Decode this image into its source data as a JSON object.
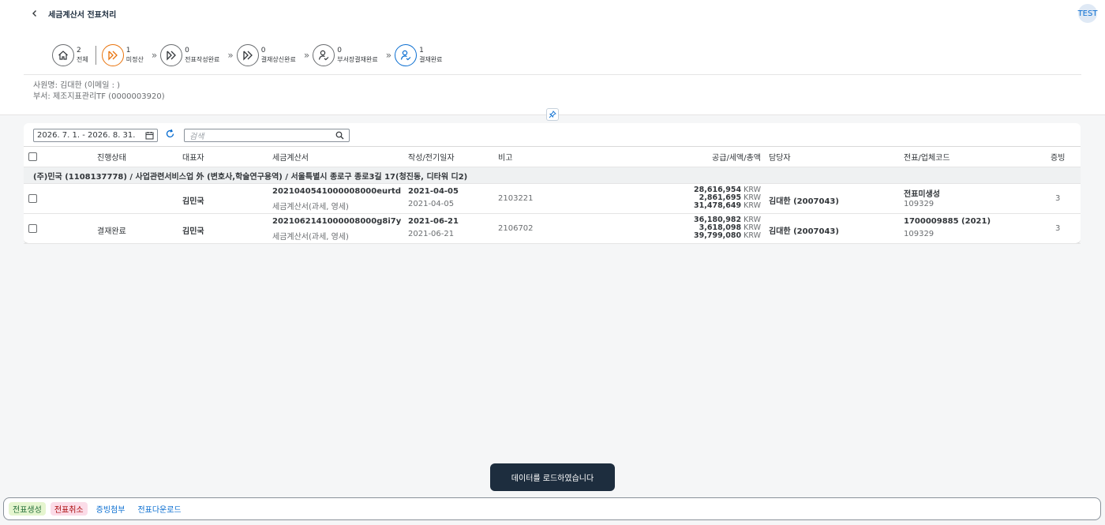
{
  "header": {
    "title": "세금계산서 전표처리",
    "user": "TEST",
    "back_icon": "chevron-left-icon"
  },
  "steps": [
    {
      "count": "2",
      "label": "전체",
      "icon": "home-icon"
    },
    {
      "count": "1",
      "label": "미정산",
      "icon": "double-chevron-icon"
    },
    {
      "count": "0",
      "label": "전표작성완료",
      "icon": "double-chevron-icon"
    },
    {
      "count": "0",
      "label": "결재상신완료",
      "icon": "double-chevron-icon"
    },
    {
      "count": "0",
      "label": "부서장결재완료",
      "icon": "user-check-icon"
    },
    {
      "count": "1",
      "label": "결재완료",
      "icon": "user-check-icon"
    }
  ],
  "employee": {
    "name_line": "사원명: 김대한 (이메일 : )",
    "dept_line": "부서: 제조지표관리TF (0000003920)"
  },
  "toolbar": {
    "date_range": "2026. 7. 1. - 2026. 8. 31.",
    "search_placeholder": "검색"
  },
  "table": {
    "columns": [
      "진행상태",
      "대표자",
      "세금계산서",
      "작성/전기일자",
      "비고",
      "공급/세액/총액",
      "담당자",
      "전표/업체코드",
      "증빙"
    ],
    "group_label": "(주)민국 (1108137778) / 사업관련서비스업 外 (변호사,학술연구용역) / 서울특별시 종로구 종로3길 17(청진동, 디타워 디2)",
    "rows": [
      {
        "status": "",
        "rep": "김민국",
        "invoice_no": "2021040541000008000eurtd",
        "invoice_type": "세금계산서(과세, 영세)",
        "date1": "2021-04-05",
        "date2": "2021-04-05",
        "memo": "2103221",
        "supply": "28,616,954",
        "tax": "2,861,695",
        "total": "31,478,649",
        "currency": "KRW",
        "manager": "김대한 (2007043)",
        "voucher": "전표미생성",
        "vendor_code": "109329",
        "evidence": "3"
      },
      {
        "status": "결재완료",
        "rep": "김민국",
        "invoice_no": "2021062141000008000g8i7y",
        "invoice_type": "세금계산서(과세, 영세)",
        "date1": "2021-06-21",
        "date2": "2021-06-21",
        "memo": "2106702",
        "supply": "36,180,982",
        "tax": "3,618,098",
        "total": "39,799,080",
        "currency": "KRW",
        "manager": "김대한 (2007043)",
        "voucher": "1700009885 (2021)",
        "vendor_code": "109329",
        "evidence": "3"
      }
    ]
  },
  "toast": "데이터를 로드하였습니다",
  "footer": {
    "create": "전표생성",
    "cancel": "전표취소",
    "attach": "증빙첨부",
    "download": "전표다운로드"
  },
  "colors": {
    "accent": "#0a6ed1",
    "active_step": "#e9730c",
    "toast_bg": "#1d2d3e"
  }
}
